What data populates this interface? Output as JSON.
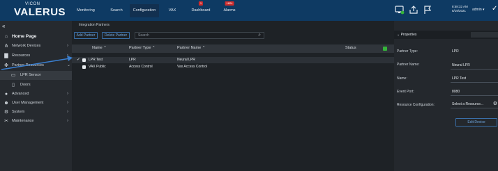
{
  "brand": {
    "small": "VICON",
    "name": "VALERUS"
  },
  "nav": {
    "tabs": [
      {
        "label": "Monitoring"
      },
      {
        "label": "Search"
      },
      {
        "label": "Configuration"
      },
      {
        "label": "VAX"
      },
      {
        "label": "Dashboard",
        "badge": "1"
      },
      {
        "label": "Alarms",
        "badge": "1824"
      }
    ],
    "time": "8:58:32 AM",
    "date": "5/19/2021",
    "user": "admin"
  },
  "sidebar": {
    "collapse_icon": "«",
    "items": [
      {
        "label": "Home Page"
      },
      {
        "label": "Network Devices"
      },
      {
        "label": "Resources"
      },
      {
        "label": "Partner Resources"
      },
      {
        "label": "LPR Sensor"
      },
      {
        "label": "Doors"
      },
      {
        "label": "Advanced"
      },
      {
        "label": "User Management"
      },
      {
        "label": "System"
      },
      {
        "label": "Maintenance"
      }
    ]
  },
  "main": {
    "breadcrumb": "Integration Partners",
    "add_label": "Add Partner",
    "delete_label": "Delete Partner",
    "search_placeholder": "Search",
    "columns": [
      "Name",
      "Partner Type",
      "Partner Name",
      "Status"
    ],
    "rows": [
      {
        "name": "LPR Test",
        "type": "LPR",
        "partner_name": "Neural LPR"
      },
      {
        "name": "VAX Public",
        "type": "Access Control",
        "partner_name": "Vax Access Control"
      }
    ]
  },
  "properties": {
    "title": "Properties",
    "fields": [
      {
        "label": "Partner Type:",
        "value": "LPR"
      },
      {
        "label": "Partner Name:",
        "value": "Neural LPR"
      },
      {
        "label": "Name:",
        "value": "LPR Test"
      },
      {
        "label": "Event Port:",
        "value": "8080"
      }
    ],
    "resource_label": "Resource Configuration:",
    "resource_value": "Select a Resource...",
    "edit_label": "Edit Device"
  },
  "colors": {
    "topbar": "#0e3a63",
    "accent": "#3a6fa8",
    "status_ok": "#35b43a",
    "annotation": "#3a7fd0"
  }
}
